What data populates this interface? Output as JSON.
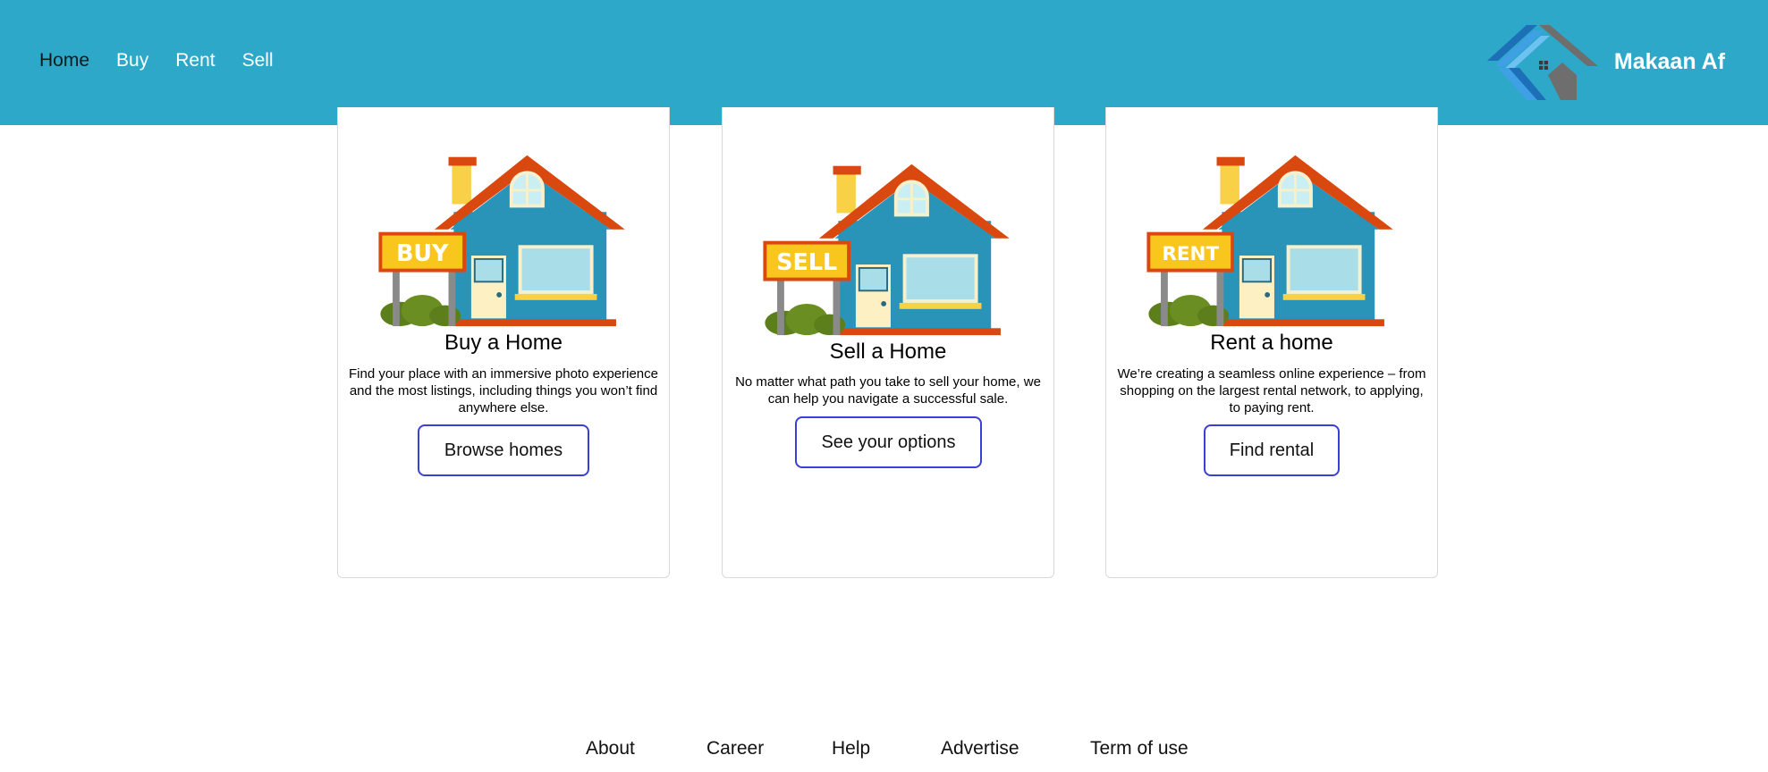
{
  "header": {
    "nav": [
      "Home",
      "Buy",
      "Rent",
      "Sell"
    ],
    "brand_name": "Makaan Af"
  },
  "cards": [
    {
      "sign_text": "BUY",
      "title": "Buy a Home",
      "text": "Find your place with an immersive photo experience and the most listings, including things you won’t find anywhere else.",
      "button": "Browse homes"
    },
    {
      "sign_text": "SELL",
      "title": "Sell a Home",
      "text": "No matter what path you take to sell your home, we can help you navigate a successful sale.",
      "button": "See your options"
    },
    {
      "sign_text": "RENT",
      "title": "Rent a home",
      "text": "We’re creating a seamless online experience – from shopping on the largest rental network, to applying, to paying rent.",
      "button": "Find rental"
    }
  ],
  "footer": {
    "links": [
      "About",
      "Career",
      "Help",
      "Advertise",
      "Term of use"
    ]
  }
}
